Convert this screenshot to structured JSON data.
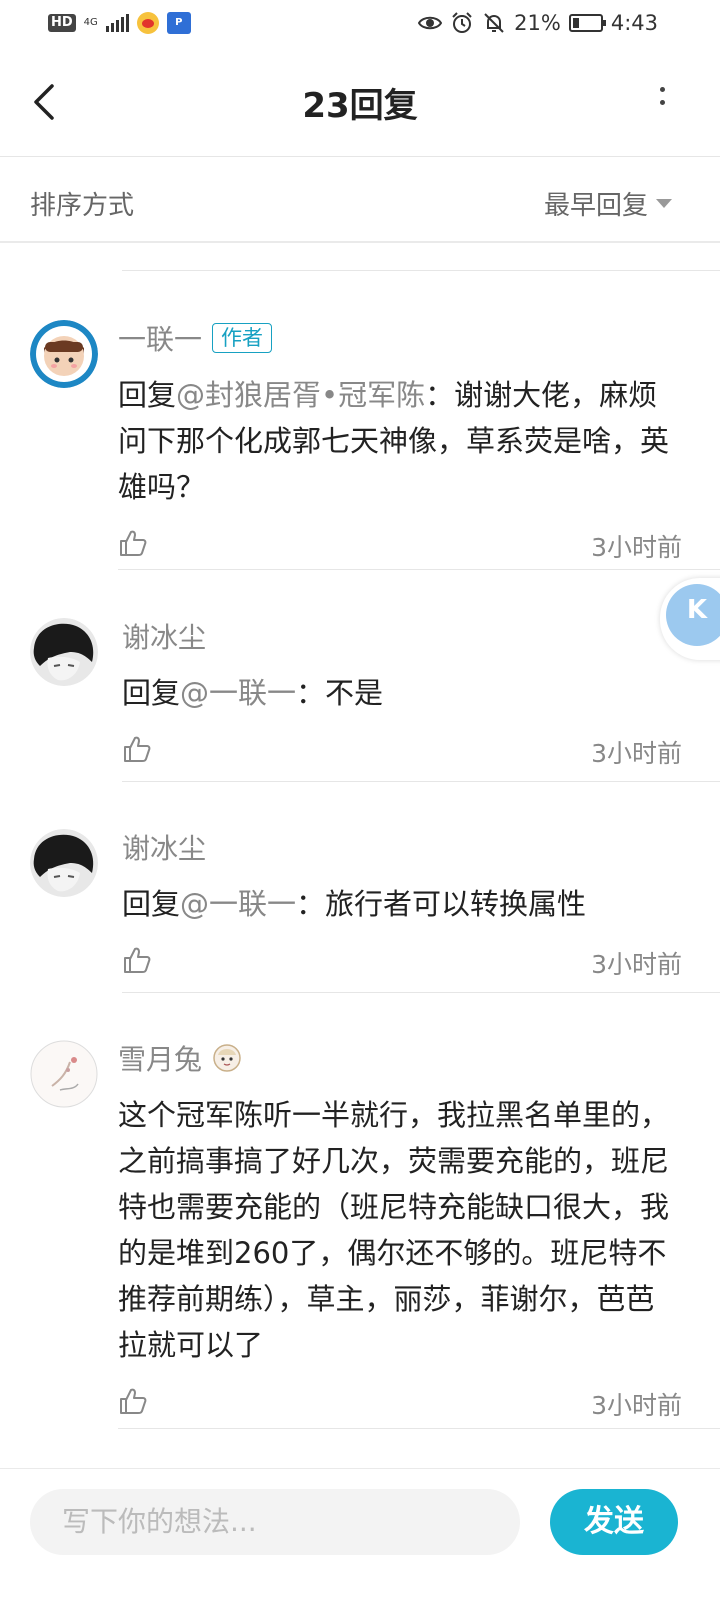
{
  "status_bar": {
    "hd": "HD",
    "network": "4G",
    "battery_percent": "21%",
    "time": "4:43",
    "icons": [
      "hd-icon",
      "signal-icon",
      "weibo-icon",
      "app-icon",
      "eye-icon",
      "alarm-icon",
      "mute-icon",
      "battery-icon"
    ]
  },
  "nav": {
    "title": "23回复"
  },
  "sort": {
    "label": "排序方式",
    "value": "最早回复"
  },
  "comments": [
    {
      "name": "一联一",
      "tag": "作者",
      "reply_prefix": "回复",
      "reply_to": "@封狼居胥•冠军陈",
      "text": "：谢谢大佬，麻烦问下那个化成郭七天神像，草系荧是啥，英雄吗？",
      "time": "3小时前"
    },
    {
      "name": "谢冰尘",
      "reply_prefix": "回复",
      "reply_to": "@一联一",
      "text": "：不是",
      "time": "3小时前"
    },
    {
      "name": "谢冰尘",
      "reply_prefix": "回复",
      "reply_to": "@一联一",
      "text": "：旅行者可以转换属性",
      "time": "3小时前"
    },
    {
      "name": "雪月兔",
      "text": "这个冠军陈听一半就行，我拉黑名单里的，之前搞事搞了好几次，荧需要充能的，班尼特也需要充能的（班尼特充能缺口很大，我的是堆到260了，偶尔还不够的。班尼特不推荐前期练），草主，丽莎，菲谢尔，芭芭拉就可以了",
      "time": "3小时前"
    }
  ],
  "bottom": {
    "placeholder": "写下你的想法...",
    "send_label": "发送"
  }
}
